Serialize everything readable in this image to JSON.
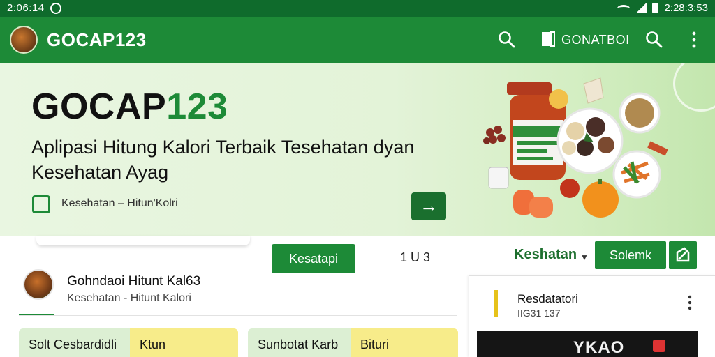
{
  "status_bar": {
    "time": "2:06:14",
    "right_time": "2:28:3:53"
  },
  "app_bar": {
    "title": "GOCAP123",
    "action_label": "GONATBOI",
    "icons": [
      "search-icon",
      "document-icon",
      "search-icon",
      "more-vertical-icon"
    ]
  },
  "hero": {
    "title_main": "GOCAP",
    "title_accent": "123",
    "subtitle": "Aplipasi Hitung Kalori Terbaik Tesehatan dyan Kesehatan Ayag",
    "chip_label": "Kesehatan – Hitun'Kolri",
    "arrow_label": "→",
    "accent_color": "#1d8a37"
  },
  "toolbar": {
    "primary_button": "Kesatapi",
    "count": "1 U 3",
    "dropdown_label": "Keshatan",
    "secondary_button": "Solemk"
  },
  "profile": {
    "name": "Gohndaoi Hitunt Kal63",
    "subtitle": "Kesehatan - Hitunt Kalori"
  },
  "tiles": [
    {
      "left": "Solt Cesbardidli",
      "right": "Ktun"
    },
    {
      "left": "Sunbotat Karb",
      "right": "Bituri"
    }
  ],
  "side_card": {
    "title": "Resdatatori",
    "subtitle": "IIG31 137",
    "thumb_text": "YKAO"
  }
}
